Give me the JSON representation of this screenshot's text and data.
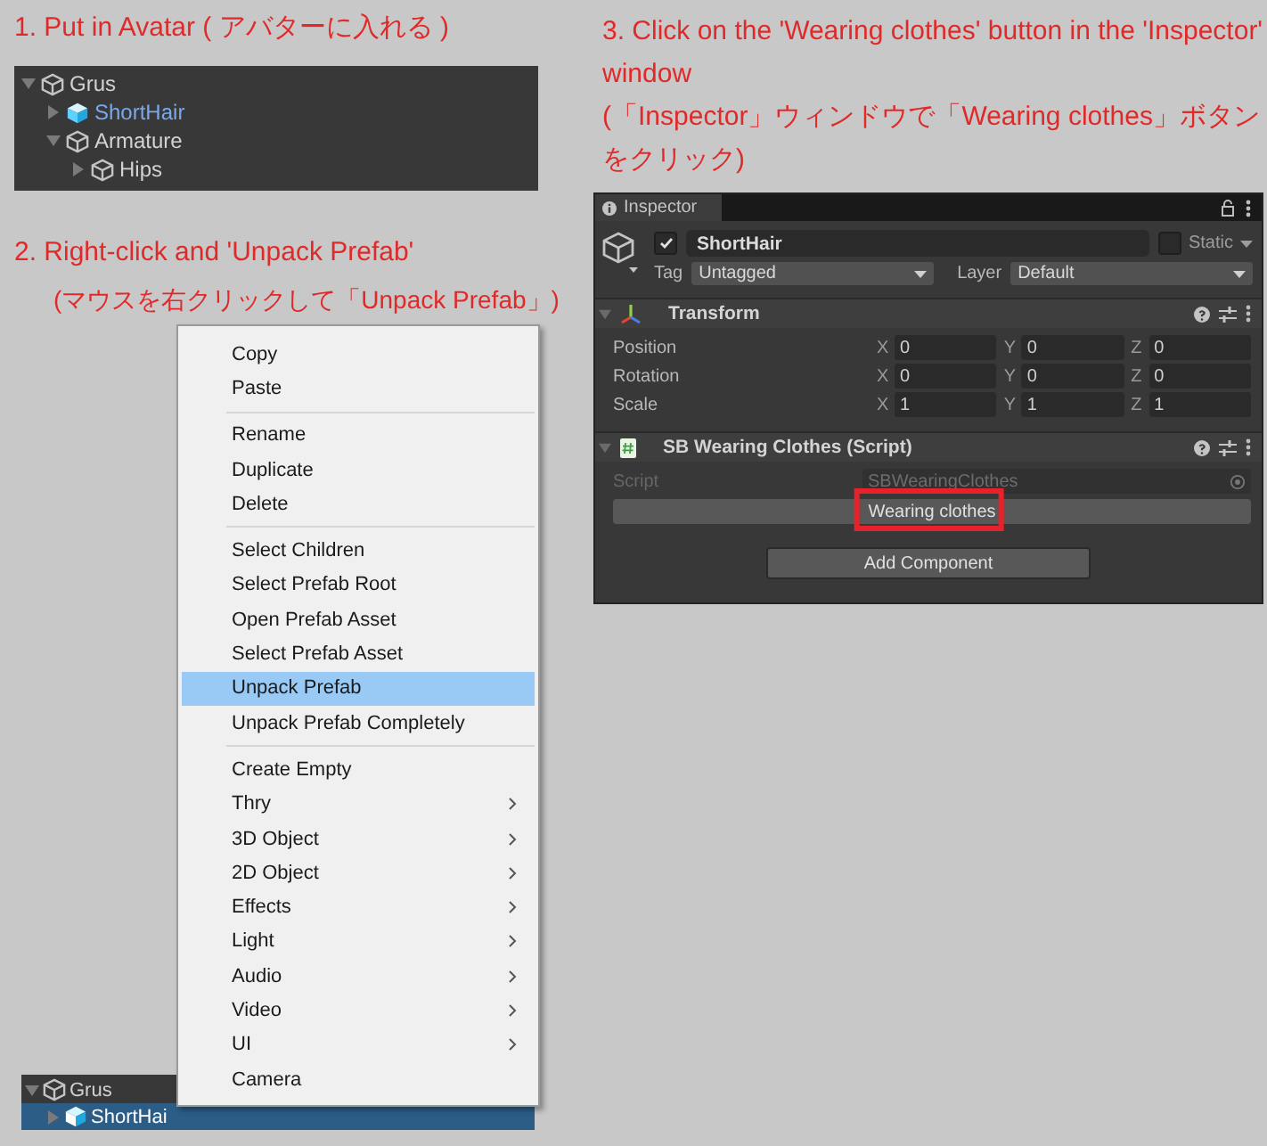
{
  "step_1": {
    "lines": [
      "1. Put in Avatar ( アバターに入れる )"
    ]
  },
  "hierarchy_top": {
    "items": [
      {
        "name": "Grus",
        "kind": "object",
        "expanded": true,
        "selected": false,
        "children": [
          {
            "name": "ShortHair",
            "kind": "prefab",
            "expanded": false,
            "selected": false
          },
          {
            "name": "Armature",
            "kind": "object",
            "expanded": true,
            "selected": false,
            "children": [
              {
                "name": "Hips",
                "kind": "object",
                "expanded": false,
                "selected": false
              }
            ]
          }
        ]
      }
    ]
  },
  "step_2": {
    "lines": [
      "2. Right-click and 'Unpack Prefab'",
      "(マウスを右クリックして「Unpack Prefab」)"
    ]
  },
  "context_menu": {
    "sections": [
      {
        "items": [
          {
            "label": "Copy",
            "selected": false,
            "submenu": false
          },
          {
            "label": "Paste",
            "selected": false,
            "submenu": false
          }
        ]
      },
      {
        "items": [
          {
            "label": "Rename",
            "selected": false,
            "submenu": false
          },
          {
            "label": "Duplicate",
            "selected": false,
            "submenu": false
          },
          {
            "label": "Delete",
            "selected": false,
            "submenu": false
          }
        ]
      },
      {
        "items": [
          {
            "label": "Select Children",
            "selected": false,
            "submenu": false
          },
          {
            "label": "Select Prefab Root",
            "selected": false,
            "submenu": false
          },
          {
            "label": "Open Prefab Asset",
            "selected": false,
            "submenu": false
          },
          {
            "label": "Select Prefab Asset",
            "selected": false,
            "submenu": false
          },
          {
            "label": "Unpack Prefab",
            "selected": true,
            "submenu": false
          },
          {
            "label": "Unpack Prefab Completely",
            "selected": false,
            "submenu": false
          }
        ]
      },
      {
        "items": [
          {
            "label": "Create Empty",
            "selected": false,
            "submenu": false
          },
          {
            "label": "Thry",
            "selected": false,
            "submenu": true
          },
          {
            "label": "3D Object",
            "selected": false,
            "submenu": true
          },
          {
            "label": "2D Object",
            "selected": false,
            "submenu": true
          },
          {
            "label": "Effects",
            "selected": false,
            "submenu": true
          },
          {
            "label": "Light",
            "selected": false,
            "submenu": true
          },
          {
            "label": "Audio",
            "selected": false,
            "submenu": true
          },
          {
            "label": "Video",
            "selected": false,
            "submenu": true
          },
          {
            "label": "UI",
            "selected": false,
            "submenu": true
          },
          {
            "label": "Camera",
            "selected": false,
            "submenu": false
          }
        ]
      }
    ]
  },
  "hierarchy_bottom": {
    "items": [
      {
        "name": "Grus",
        "kind": "object",
        "expanded": true,
        "selected": false,
        "children": [
          {
            "name": "ShortHai",
            "kind": "prefab",
            "expanded": false,
            "selected": true
          }
        ]
      }
    ]
  },
  "step_3": {
    "lines": [
      "3. Click on the 'Wearing clothes' button in the 'Inspector' window",
      "(「Inspector」ウィンドウで「Wearing clothes」ボタンをクリック)"
    ]
  },
  "inspector": {
    "tab": "Inspector",
    "object": {
      "active": true,
      "name": "ShortHair",
      "static": false,
      "static_label": "Static",
      "tag_label": "Tag",
      "tag": "Untagged",
      "layer_label": "Layer",
      "layer": "Default"
    },
    "components": [
      {
        "kind": "transform",
        "title": "Transform",
        "expanded": true,
        "rows": [
          {
            "label": "Position",
            "fields": [
              {
                "axis": "X",
                "value": "0"
              },
              {
                "axis": "Y",
                "value": "0"
              },
              {
                "axis": "Z",
                "value": "0"
              }
            ]
          },
          {
            "label": "Rotation",
            "fields": [
              {
                "axis": "X",
                "value": "0"
              },
              {
                "axis": "Y",
                "value": "0"
              },
              {
                "axis": "Z",
                "value": "0"
              }
            ]
          },
          {
            "label": "Scale",
            "fields": [
              {
                "axis": "X",
                "value": "1"
              },
              {
                "axis": "Y",
                "value": "1"
              },
              {
                "axis": "Z",
                "value": "1"
              }
            ]
          }
        ]
      },
      {
        "kind": "script",
        "title": "SB Wearing Clothes (Script)",
        "expanded": true,
        "script_label": "Script",
        "script": "SBWearingClothes",
        "button": "Wearing clothes",
        "button_highlighted": true
      }
    ],
    "add_component": "Add Component"
  }
}
